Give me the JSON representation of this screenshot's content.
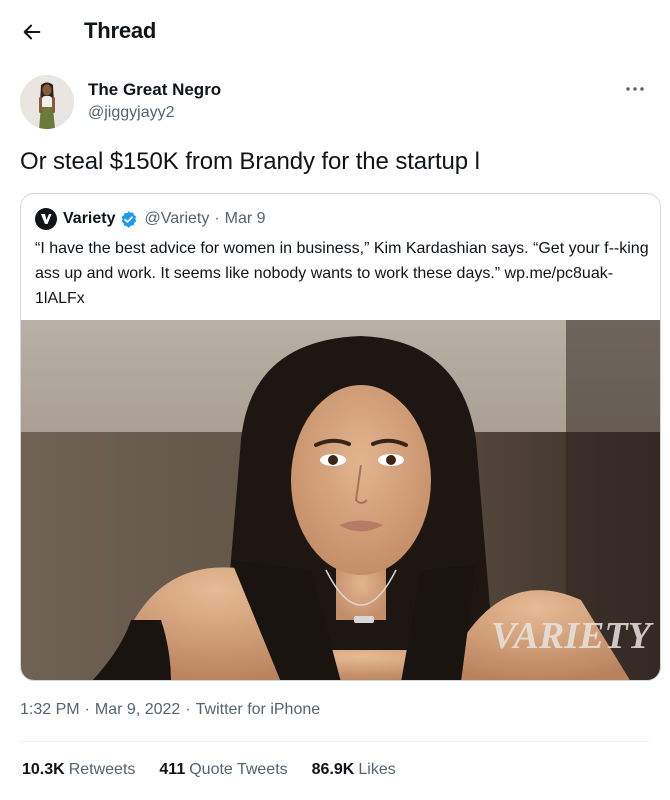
{
  "header": {
    "back_icon": "arrow-left-icon",
    "title": "Thread"
  },
  "tweet": {
    "author_name": "The Great Negro",
    "author_handle": "@jiggyjayy2",
    "more_icon": "more-horizontal-icon",
    "text": "Or steal $150K from Brandy for the startup l",
    "timestamp": "1:32 PM",
    "date": "Mar 9, 2022",
    "source": "Twitter for iPhone",
    "meta_separator": "·"
  },
  "quote": {
    "author_name": "Variety",
    "verified_icon": "verified-badge-icon",
    "author_handle": "@Variety",
    "separator": "·",
    "date": "Mar 9",
    "text": "“I have the best advice for women in business,” Kim Kardashian says. “Get your f--king ass up and work. It seems like nobody wants to work these days.” wp.me/pc8uak-1lALFx",
    "image_watermark": "VARIETY"
  },
  "stats": {
    "retweets_count": "10.3K",
    "retweets_label": "Retweets",
    "quote_tweets_count": "411",
    "quote_tweets_label": "Quote Tweets",
    "likes_count": "86.9K",
    "likes_label": "Likes"
  },
  "colors": {
    "text_primary": "#0f1419",
    "text_secondary": "#536471",
    "verified_blue": "#1d9bf0",
    "border": "#cfd9de"
  }
}
